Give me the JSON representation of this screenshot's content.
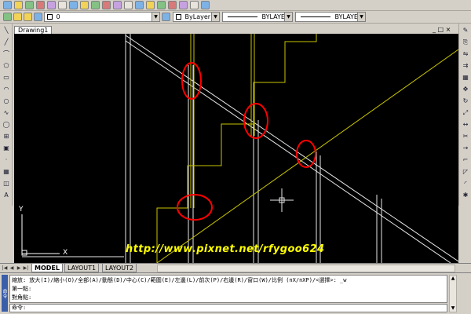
{
  "layer_toolbar": {
    "layer_name": "0",
    "color_value": "ByLayer",
    "linetype_value": "BYLAYER",
    "lineweight_value": "BYLAYER"
  },
  "document": {
    "tab_title": "Drawing1",
    "window_controls": "_ □ ×"
  },
  "layout_tabs": [
    {
      "label": "MODEL",
      "active": true
    },
    {
      "label": "LAYOUT1",
      "active": false
    },
    {
      "label": "LAYOUT2",
      "active": false
    }
  ],
  "watermark": "http://www.pixnet.net/rfygoo624",
  "ucs": {
    "y_label": "Y",
    "x_label": "X"
  },
  "command_window": {
    "grip_label": "命令",
    "history": [
      "縮放: 放大(I)/縮小(O)/全部(A)/動態(D)/中心(C)/範圍(E)/左邊(L)/前次(P)/右邊(R)/窗口(W)/比例 (nX/nXP)/<選擇>: _w",
      "第一點:",
      "對角點:"
    ],
    "prompt": "命令:"
  },
  "colors": {
    "canvas_bg": "#000000",
    "stair_yellow": "#c8c400",
    "white_lines": "#e8e8e8",
    "highlight_red": "#ff0000",
    "watermark_yellow": "#ffff00"
  },
  "icons": {
    "top_row_1": [
      "new-icon",
      "open-icon",
      "save-icon",
      "print-icon",
      "preview-icon",
      "plot-icon",
      "cut-icon",
      "copy-icon",
      "paste-icon",
      "match-icon",
      "undo-icon",
      "redo-icon",
      "pan-icon",
      "zoom-icon",
      "zoom-window-icon",
      "zoom-prev-icon",
      "properties-icon",
      "design-center-icon",
      "help-icon"
    ],
    "left_tools": [
      "line-icon",
      "xline-icon",
      "polyline-icon",
      "polygon-icon",
      "rectangle-icon",
      "arc-icon",
      "circle-icon",
      "spline-icon",
      "ellipse-icon",
      "insert-icon",
      "block-icon",
      "point-icon",
      "hatch-icon",
      "region-icon",
      "text-icon"
    ],
    "right_tools": [
      "erase-icon",
      "copy-obj-icon",
      "mirror-icon",
      "offset-icon",
      "array-icon",
      "move-icon",
      "rotate-icon",
      "scale-icon",
      "stretch-icon",
      "trim-icon",
      "extend-icon",
      "break-icon",
      "chamfer-icon",
      "fillet-icon",
      "explode-icon"
    ]
  }
}
